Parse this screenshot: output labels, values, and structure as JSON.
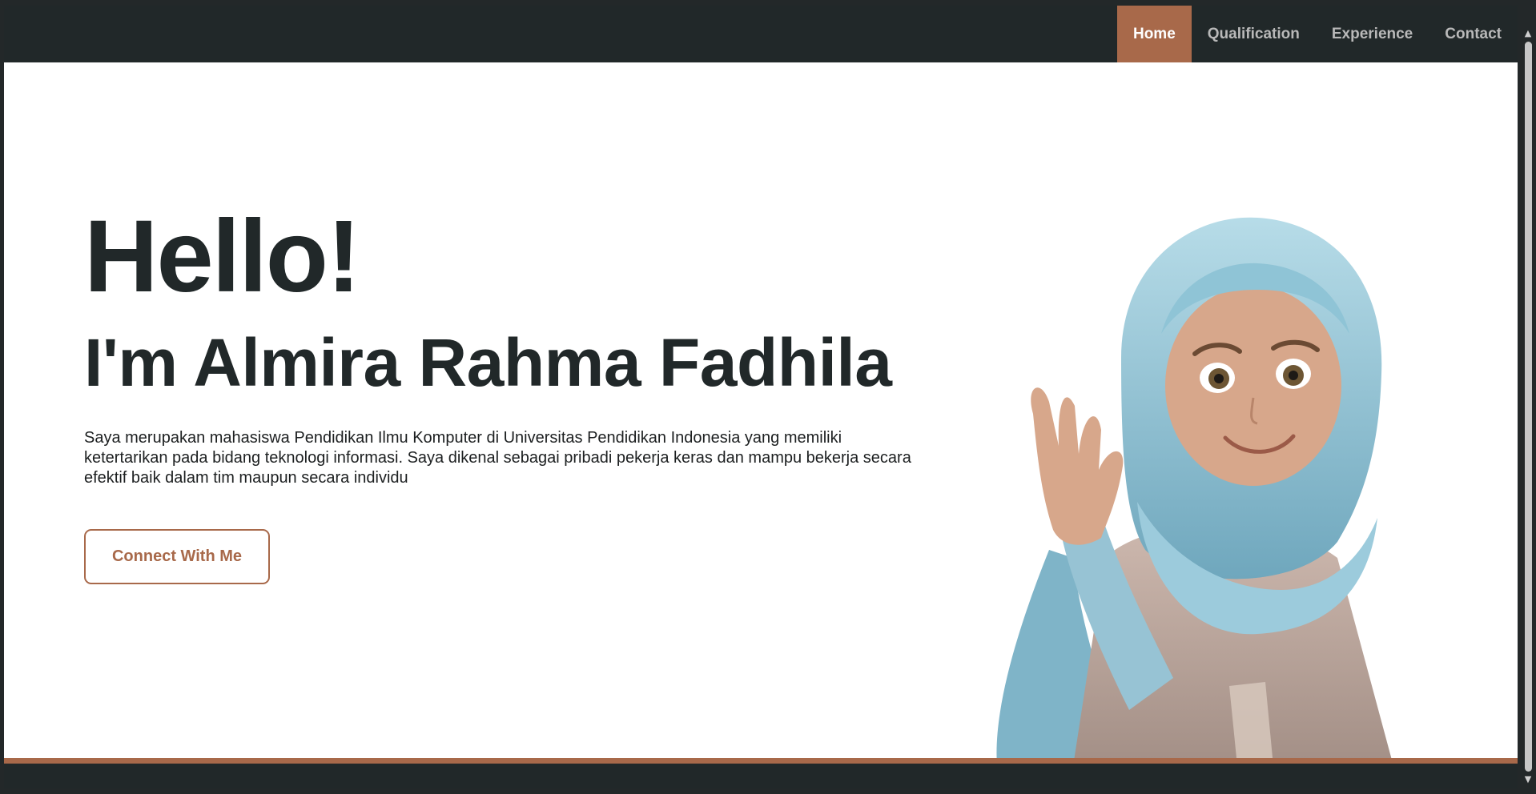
{
  "nav": {
    "items": [
      {
        "label": "Home",
        "active": true
      },
      {
        "label": "Qualification",
        "active": false
      },
      {
        "label": "Experience",
        "active": false
      },
      {
        "label": "Contact",
        "active": false
      }
    ]
  },
  "hero": {
    "greeting": "Hello!",
    "name": "I'm Almira Rahma Fadhila",
    "bio": "Saya merupakan mahasiswa Pendidikan Ilmu Komputer di Universitas Pendidikan Indonesia yang memiliki ketertarikan pada bidang teknologi informasi. Saya dikenal sebagai pribadi pekerja keras dan mampu bekerja secara efektif baik dalam tim maupun secara individu",
    "cta_label": "Connect With Me"
  },
  "colors": {
    "accent": "#a8694a",
    "dark": "#212829",
    "hijab": "#8fc4d6",
    "skin": "#d7a78b"
  },
  "icons": {
    "scroll_up": "triangle-up-icon",
    "scroll_down": "triangle-down-icon"
  }
}
